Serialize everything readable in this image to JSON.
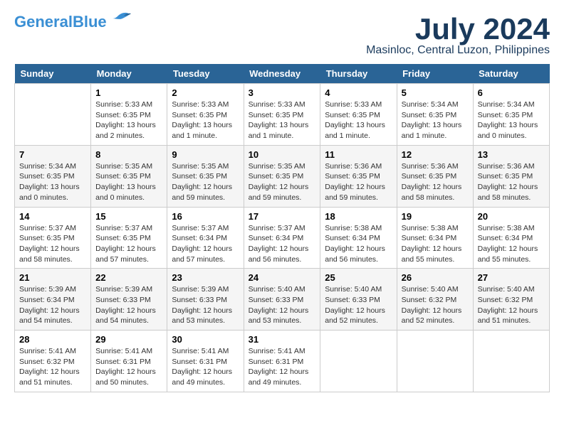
{
  "header": {
    "logo_line1": "General",
    "logo_line2": "Blue",
    "month_title": "July 2024",
    "location": "Masinloc, Central Luzon, Philippines"
  },
  "calendar": {
    "days_of_week": [
      "Sunday",
      "Monday",
      "Tuesday",
      "Wednesday",
      "Thursday",
      "Friday",
      "Saturday"
    ],
    "weeks": [
      [
        {
          "day": "",
          "content": ""
        },
        {
          "day": "1",
          "content": "Sunrise: 5:33 AM\nSunset: 6:35 PM\nDaylight: 13 hours\nand 2 minutes."
        },
        {
          "day": "2",
          "content": "Sunrise: 5:33 AM\nSunset: 6:35 PM\nDaylight: 13 hours\nand 1 minute."
        },
        {
          "day": "3",
          "content": "Sunrise: 5:33 AM\nSunset: 6:35 PM\nDaylight: 13 hours\nand 1 minute."
        },
        {
          "day": "4",
          "content": "Sunrise: 5:33 AM\nSunset: 6:35 PM\nDaylight: 13 hours\nand 1 minute."
        },
        {
          "day": "5",
          "content": "Sunrise: 5:34 AM\nSunset: 6:35 PM\nDaylight: 13 hours\nand 1 minute."
        },
        {
          "day": "6",
          "content": "Sunrise: 5:34 AM\nSunset: 6:35 PM\nDaylight: 13 hours\nand 0 minutes."
        }
      ],
      [
        {
          "day": "7",
          "content": "Sunrise: 5:34 AM\nSunset: 6:35 PM\nDaylight: 13 hours\nand 0 minutes."
        },
        {
          "day": "8",
          "content": "Sunrise: 5:35 AM\nSunset: 6:35 PM\nDaylight: 13 hours\nand 0 minutes."
        },
        {
          "day": "9",
          "content": "Sunrise: 5:35 AM\nSunset: 6:35 PM\nDaylight: 12 hours\nand 59 minutes."
        },
        {
          "day": "10",
          "content": "Sunrise: 5:35 AM\nSunset: 6:35 PM\nDaylight: 12 hours\nand 59 minutes."
        },
        {
          "day": "11",
          "content": "Sunrise: 5:36 AM\nSunset: 6:35 PM\nDaylight: 12 hours\nand 59 minutes."
        },
        {
          "day": "12",
          "content": "Sunrise: 5:36 AM\nSunset: 6:35 PM\nDaylight: 12 hours\nand 58 minutes."
        },
        {
          "day": "13",
          "content": "Sunrise: 5:36 AM\nSunset: 6:35 PM\nDaylight: 12 hours\nand 58 minutes."
        }
      ],
      [
        {
          "day": "14",
          "content": "Sunrise: 5:37 AM\nSunset: 6:35 PM\nDaylight: 12 hours\nand 58 minutes."
        },
        {
          "day": "15",
          "content": "Sunrise: 5:37 AM\nSunset: 6:35 PM\nDaylight: 12 hours\nand 57 minutes."
        },
        {
          "day": "16",
          "content": "Sunrise: 5:37 AM\nSunset: 6:34 PM\nDaylight: 12 hours\nand 57 minutes."
        },
        {
          "day": "17",
          "content": "Sunrise: 5:37 AM\nSunset: 6:34 PM\nDaylight: 12 hours\nand 56 minutes."
        },
        {
          "day": "18",
          "content": "Sunrise: 5:38 AM\nSunset: 6:34 PM\nDaylight: 12 hours\nand 56 minutes."
        },
        {
          "day": "19",
          "content": "Sunrise: 5:38 AM\nSunset: 6:34 PM\nDaylight: 12 hours\nand 55 minutes."
        },
        {
          "day": "20",
          "content": "Sunrise: 5:38 AM\nSunset: 6:34 PM\nDaylight: 12 hours\nand 55 minutes."
        }
      ],
      [
        {
          "day": "21",
          "content": "Sunrise: 5:39 AM\nSunset: 6:34 PM\nDaylight: 12 hours\nand 54 minutes."
        },
        {
          "day": "22",
          "content": "Sunrise: 5:39 AM\nSunset: 6:33 PM\nDaylight: 12 hours\nand 54 minutes."
        },
        {
          "day": "23",
          "content": "Sunrise: 5:39 AM\nSunset: 6:33 PM\nDaylight: 12 hours\nand 53 minutes."
        },
        {
          "day": "24",
          "content": "Sunrise: 5:40 AM\nSunset: 6:33 PM\nDaylight: 12 hours\nand 53 minutes."
        },
        {
          "day": "25",
          "content": "Sunrise: 5:40 AM\nSunset: 6:33 PM\nDaylight: 12 hours\nand 52 minutes."
        },
        {
          "day": "26",
          "content": "Sunrise: 5:40 AM\nSunset: 6:32 PM\nDaylight: 12 hours\nand 52 minutes."
        },
        {
          "day": "27",
          "content": "Sunrise: 5:40 AM\nSunset: 6:32 PM\nDaylight: 12 hours\nand 51 minutes."
        }
      ],
      [
        {
          "day": "28",
          "content": "Sunrise: 5:41 AM\nSunset: 6:32 PM\nDaylight: 12 hours\nand 51 minutes."
        },
        {
          "day": "29",
          "content": "Sunrise: 5:41 AM\nSunset: 6:31 PM\nDaylight: 12 hours\nand 50 minutes."
        },
        {
          "day": "30",
          "content": "Sunrise: 5:41 AM\nSunset: 6:31 PM\nDaylight: 12 hours\nand 49 minutes."
        },
        {
          "day": "31",
          "content": "Sunrise: 5:41 AM\nSunset: 6:31 PM\nDaylight: 12 hours\nand 49 minutes."
        },
        {
          "day": "",
          "content": ""
        },
        {
          "day": "",
          "content": ""
        },
        {
          "day": "",
          "content": ""
        }
      ]
    ]
  }
}
